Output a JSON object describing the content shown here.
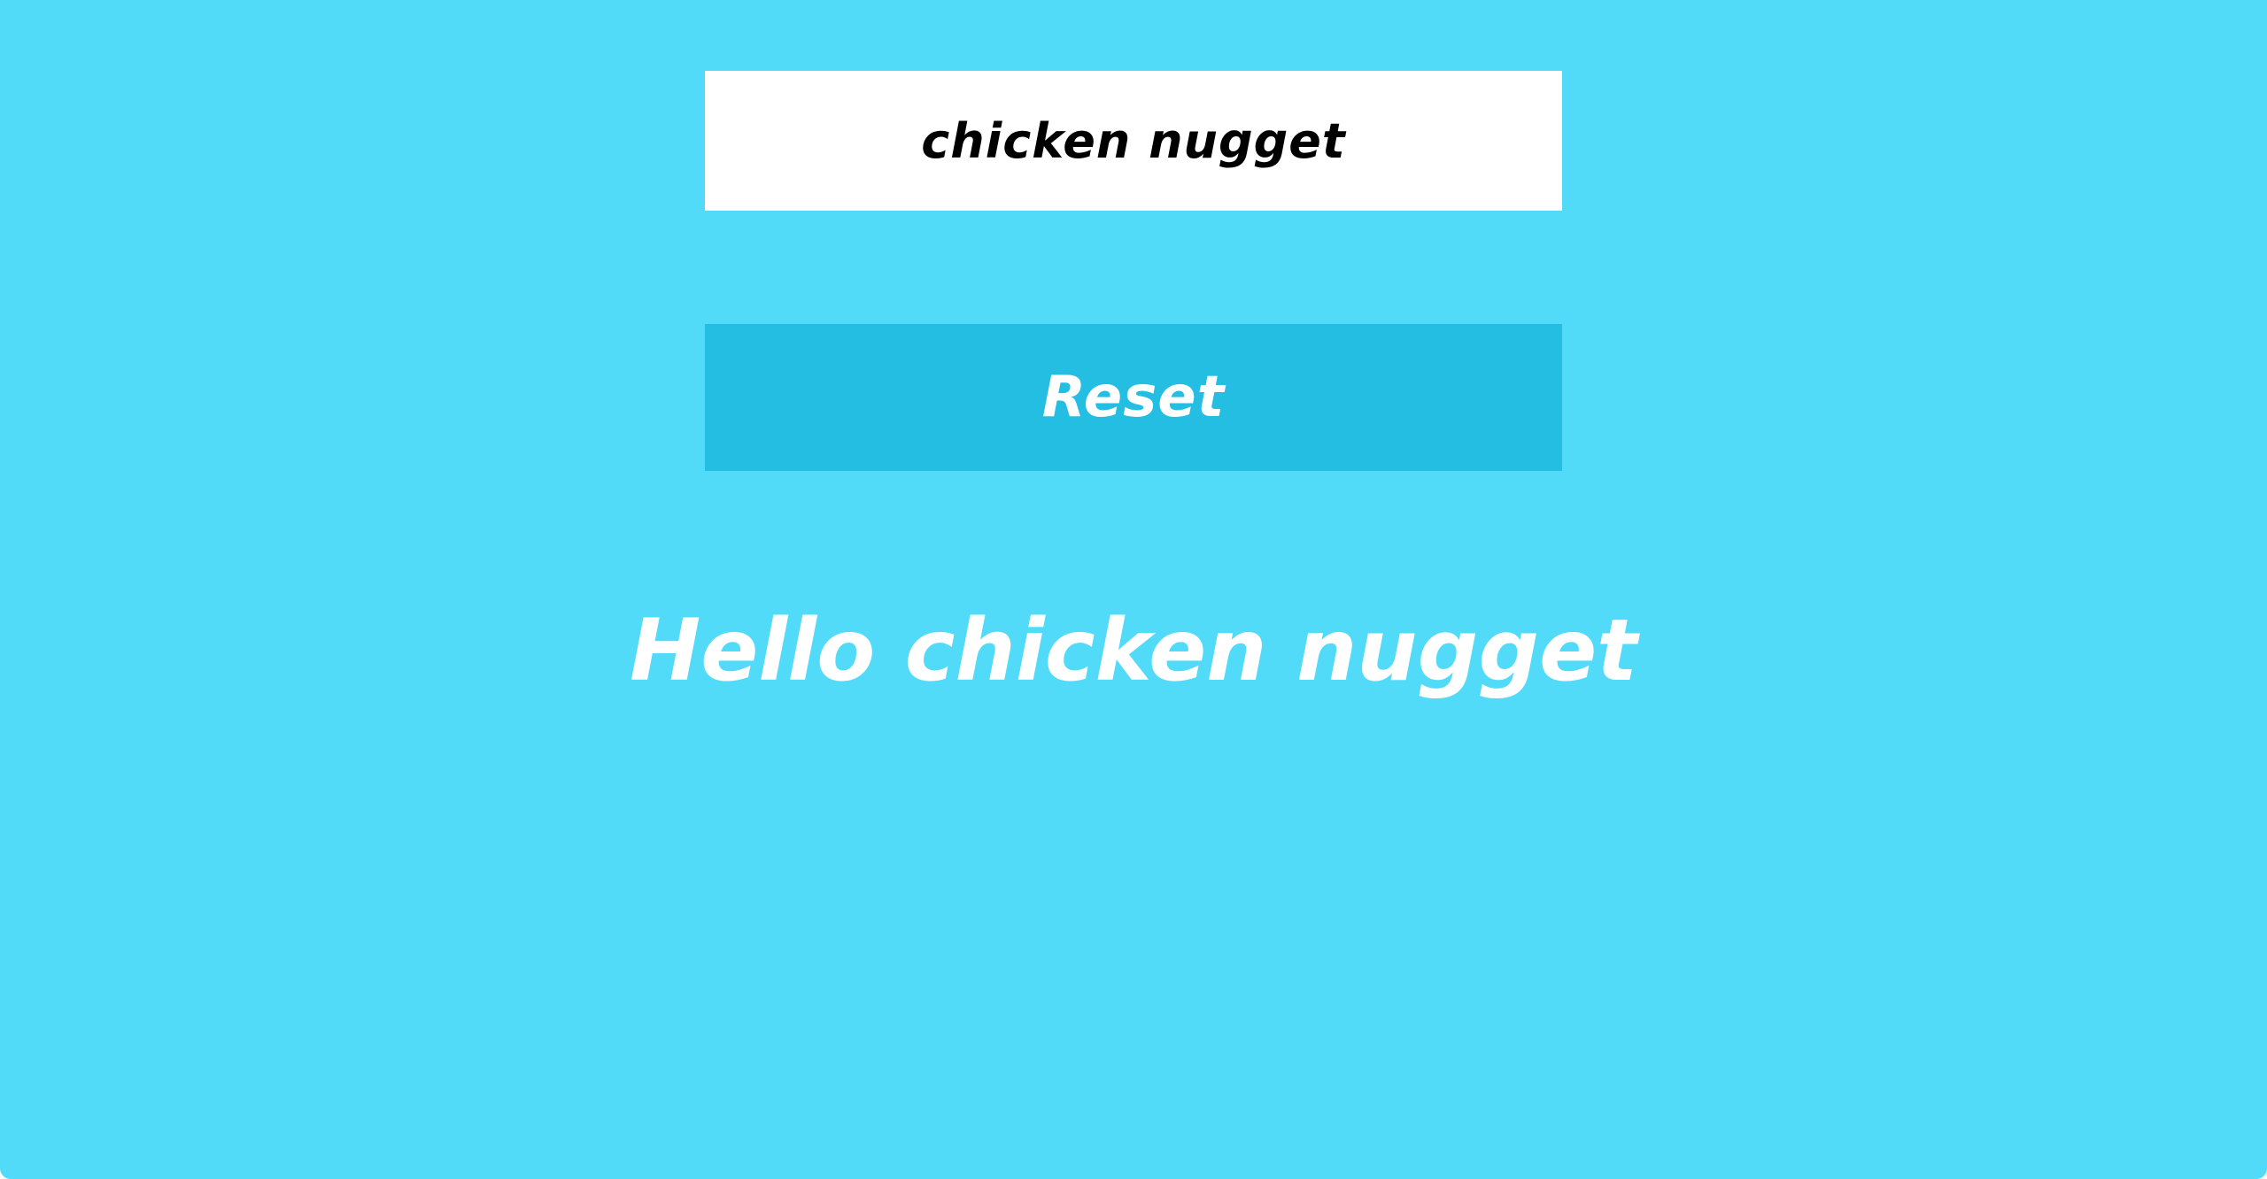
{
  "colors": {
    "background": "#52dbf8",
    "input_background": "#ffffff",
    "button_background": "#25bee3",
    "text_light": "#ffffff",
    "text_dark": "#000000"
  },
  "name_input": {
    "value": "chicken nugget"
  },
  "reset_button": {
    "label": "Reset"
  },
  "greeting": {
    "text": "Hello chicken nugget"
  }
}
